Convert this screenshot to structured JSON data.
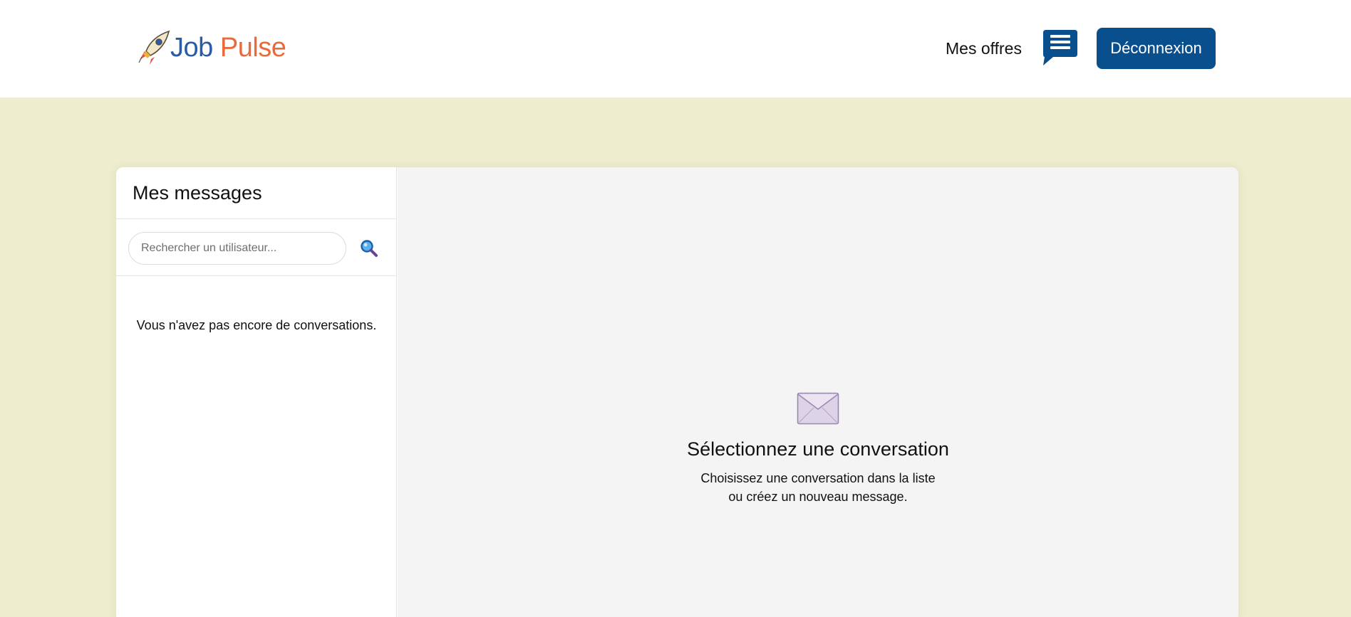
{
  "header": {
    "logo_text_1": "Job",
    "logo_text_2": "Pulse",
    "nav_offers": "Mes offres",
    "chat_icon": "chat-bubble-icon",
    "logout_label": "Déconnexion"
  },
  "sidebar": {
    "title": "Mes messages",
    "search_placeholder": "Rechercher un utilisateur...",
    "search_icon": "search-icon",
    "empty_text": "Vous n'avez pas encore de conversations."
  },
  "main": {
    "icon": "envelope-icon",
    "title": "Sélectionnez une conversation",
    "subtitle_line1": "Choisissez une conversation dans la liste",
    "subtitle_line2": "ou créez un nouveau message."
  },
  "colors": {
    "page_background": "#eeeecf",
    "brand_blue": "#0a4f8d",
    "logo_blue": "#2a5aa8",
    "logo_orange": "#ea6a3a",
    "main_panel_background": "#f4f4f4"
  }
}
